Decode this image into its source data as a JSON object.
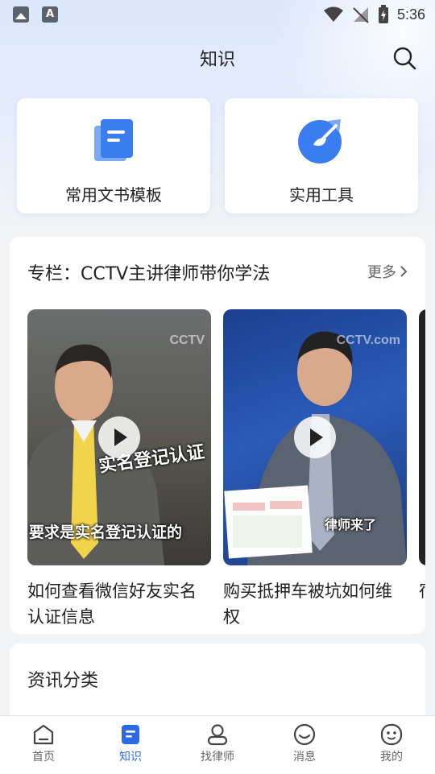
{
  "status_bar": {
    "time": "5:36",
    "left_icons": [
      "image-icon",
      "font-icon"
    ],
    "font_glyph": "A"
  },
  "header": {
    "title": "知识",
    "search_icon": "search-icon"
  },
  "quick_cards": [
    {
      "label": "常用文书模板",
      "icon": "document-template-icon"
    },
    {
      "label": "实用工具",
      "icon": "tools-icon"
    }
  ],
  "column_section": {
    "title": "专栏：CCTV主讲律师带你学法",
    "more_label": "更多",
    "videos": [
      {
        "title": "如何查看微信好友实名认证信息",
        "overlay_text_1": "实名登记认证",
        "overlay_text_2": "要求是实名登记认证的",
        "watermark": "CCTV"
      },
      {
        "title": "购买抵押车被坑如何维权",
        "overlay_text_1": "律师来了",
        "watermark": "CCTV.com"
      },
      {
        "title": "宿新"
      }
    ]
  },
  "news_section": {
    "title": "资讯分类"
  },
  "bottom_nav": [
    {
      "label": "首页",
      "icon": "home-icon",
      "active": false
    },
    {
      "label": "知识",
      "icon": "knowledge-icon",
      "active": true
    },
    {
      "label": "找律师",
      "icon": "lawyer-icon",
      "active": false
    },
    {
      "label": "消息",
      "icon": "message-icon",
      "active": false
    },
    {
      "label": "我的",
      "icon": "profile-icon",
      "active": false
    }
  ],
  "colors": {
    "accent": "#2f6ae6",
    "card_icon_blue": "#3a7df0"
  }
}
